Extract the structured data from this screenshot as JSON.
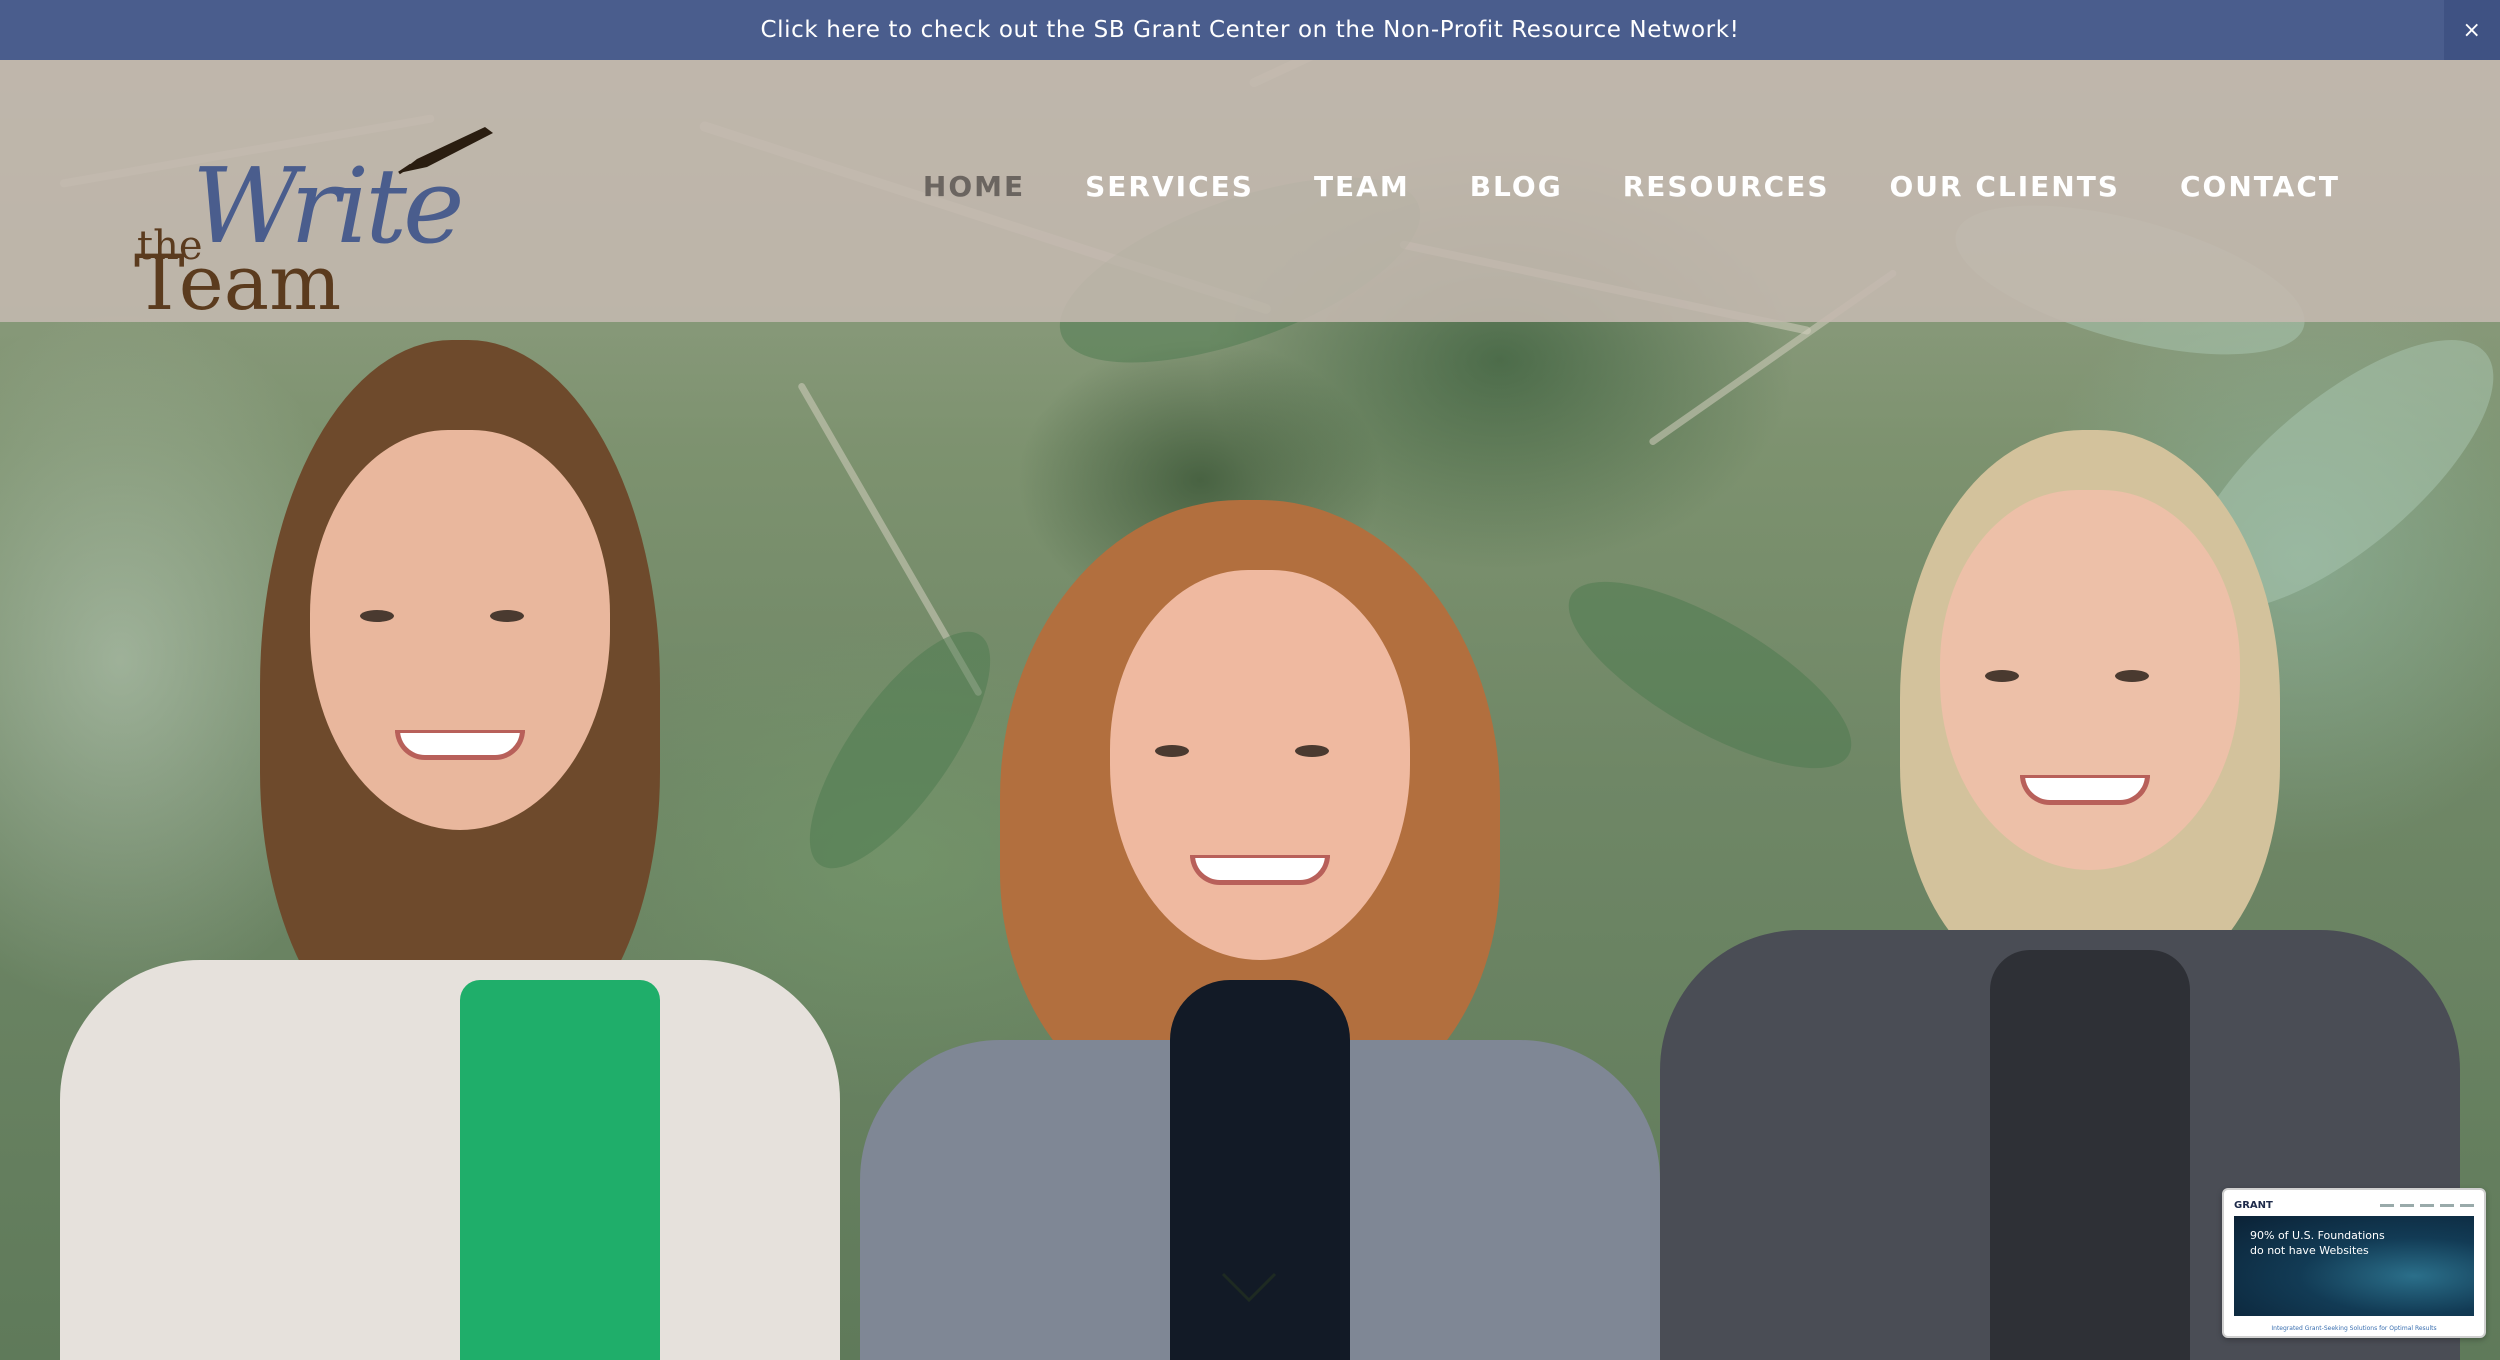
{
  "announcement": {
    "text": "Click here to check out the SB Grant Center on the Non-Profit Resource Network!",
    "close_symbol": "×"
  },
  "logo": {
    "the": "the",
    "write": "Write",
    "team": "Team"
  },
  "nav": {
    "items": [
      {
        "label": "HOME",
        "active": true
      },
      {
        "label": "SERVICES",
        "active": false
      },
      {
        "label": "TEAM",
        "active": false
      },
      {
        "label": "BLOG",
        "active": false
      },
      {
        "label": "RESOURCES",
        "active": false
      },
      {
        "label": "OUR CLIENTS",
        "active": false
      },
      {
        "label": "CONTACT",
        "active": false
      }
    ]
  },
  "icons": {
    "scroll": "chevron-down-icon",
    "close": "close-icon",
    "pen": "pen-icon"
  },
  "preview": {
    "brand": "GRANT",
    "headline_line1": "90% of U.S. Foundations",
    "headline_line2": "do not have Websites",
    "footer": "Integrated Grant-Seeking Solutions for Optimal Results"
  },
  "colors": {
    "announcement_bg": "#4a5d8d",
    "logo_blue": "#4a5d8d",
    "logo_brown": "#5b3b1e",
    "nav_active": "#6b6560",
    "nav_text": "#ffffff"
  }
}
